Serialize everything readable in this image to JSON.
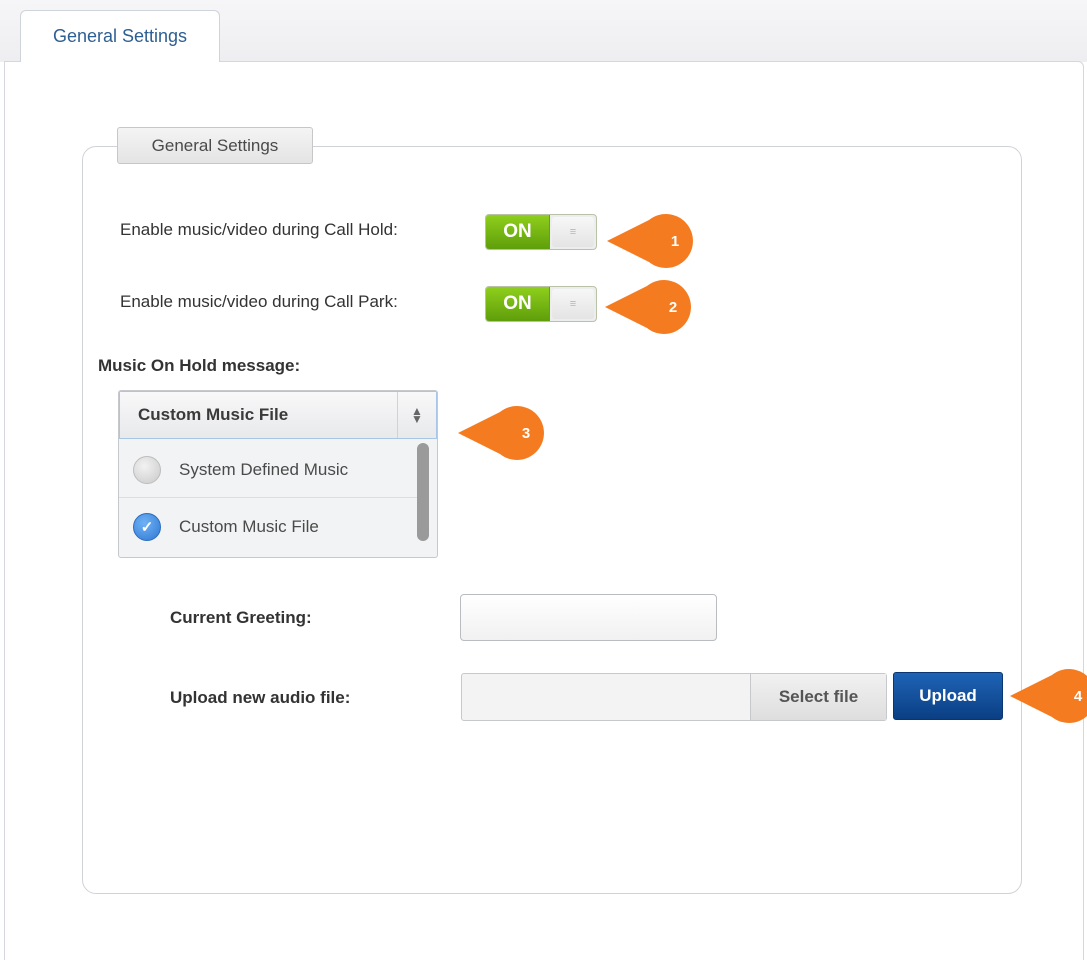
{
  "tab": {
    "label": "General Settings"
  },
  "section": {
    "legend": "General Settings"
  },
  "call_hold": {
    "label": "Enable music/video during Call Hold:",
    "toggle_state": "ON"
  },
  "call_park": {
    "label": "Enable music/video during Call Park:",
    "toggle_state": "ON"
  },
  "music_on_hold": {
    "heading": "Music On Hold message:",
    "selected_value": "Custom Music File",
    "options": [
      {
        "label": "System Defined Music",
        "selected": false
      },
      {
        "label": "Custom Music File",
        "selected": true
      }
    ]
  },
  "current_greeting": {
    "label": "Current Greeting:",
    "value": ""
  },
  "upload": {
    "label": "Upload new audio file:",
    "select_file_label": "Select file",
    "upload_label": "Upload"
  },
  "callouts": [
    "1",
    "2",
    "3",
    "4"
  ],
  "colors": {
    "toggle_on": "#6fae12",
    "callout": "#f47b20",
    "upload_button": "#0e4a98",
    "tab_text": "#2d5f93",
    "radio_checked": "#2f78d4"
  },
  "icons": {
    "select_arrow": "updown-chevron-icon",
    "radio_checked": "checkmark-icon",
    "toggle_knob": "grip-icon"
  }
}
